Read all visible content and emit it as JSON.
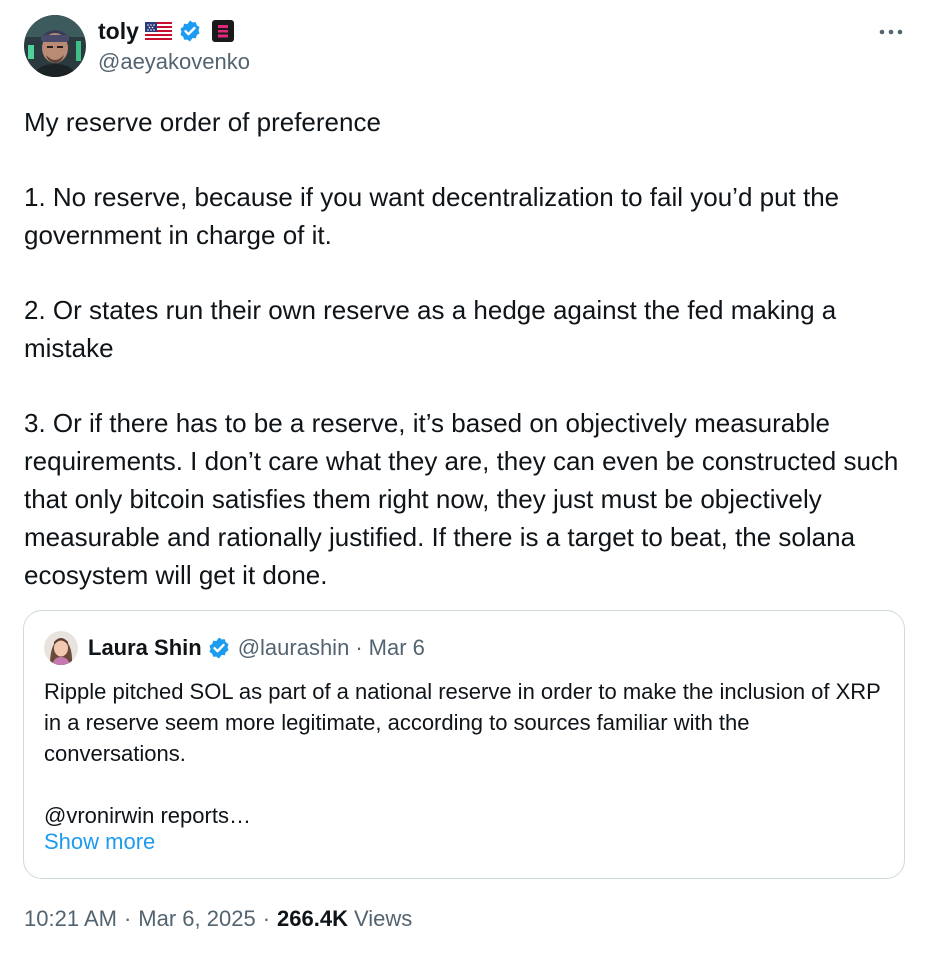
{
  "author": {
    "display_name": "toly",
    "handle": "@aeyakovenko",
    "flag_icon": "us-flag-icon",
    "verified_icon": "verified-badge-icon",
    "affiliation_icon": "affiliate-logo-icon"
  },
  "more_icon": "more-horizontal-icon",
  "tweet": {
    "paragraphs": [
      "My reserve order of preference",
      "1. No reserve, because if you want decentralization to fail you’d put the government in charge of it.",
      "2. Or states run their own reserve as a hedge against the fed making a mistake",
      "3. Or if there has to be a reserve, it’s based on objectively measurable requirements. I don’t care what they are, they can even be constructed such that only bitcoin satisfies them right now, they just must be objectively measurable and rationally justified. If there is a target to beat, the solana ecosystem will get it done."
    ]
  },
  "quote": {
    "display_name": "Laura Shin",
    "handle": "@laurashin",
    "separator": "·",
    "date": "Mar 6",
    "paragraphs": [
      "Ripple pitched SOL as part of a national reserve in order to make the inclusion of XRP in a reserve seem more legitimate, according to sources familiar with the conversations.",
      "@vronirwin reports…"
    ],
    "show_more": "Show more"
  },
  "meta": {
    "time": "10:21 AM",
    "separator": "·",
    "date": "Mar 6, 2025",
    "views_count": "266.4K",
    "views_label": "Views"
  },
  "colors": {
    "text": "#0f1419",
    "secondary": "#536471",
    "link": "#1d9bf0",
    "verified": "#1d9bf0",
    "border": "#cfd9de"
  }
}
